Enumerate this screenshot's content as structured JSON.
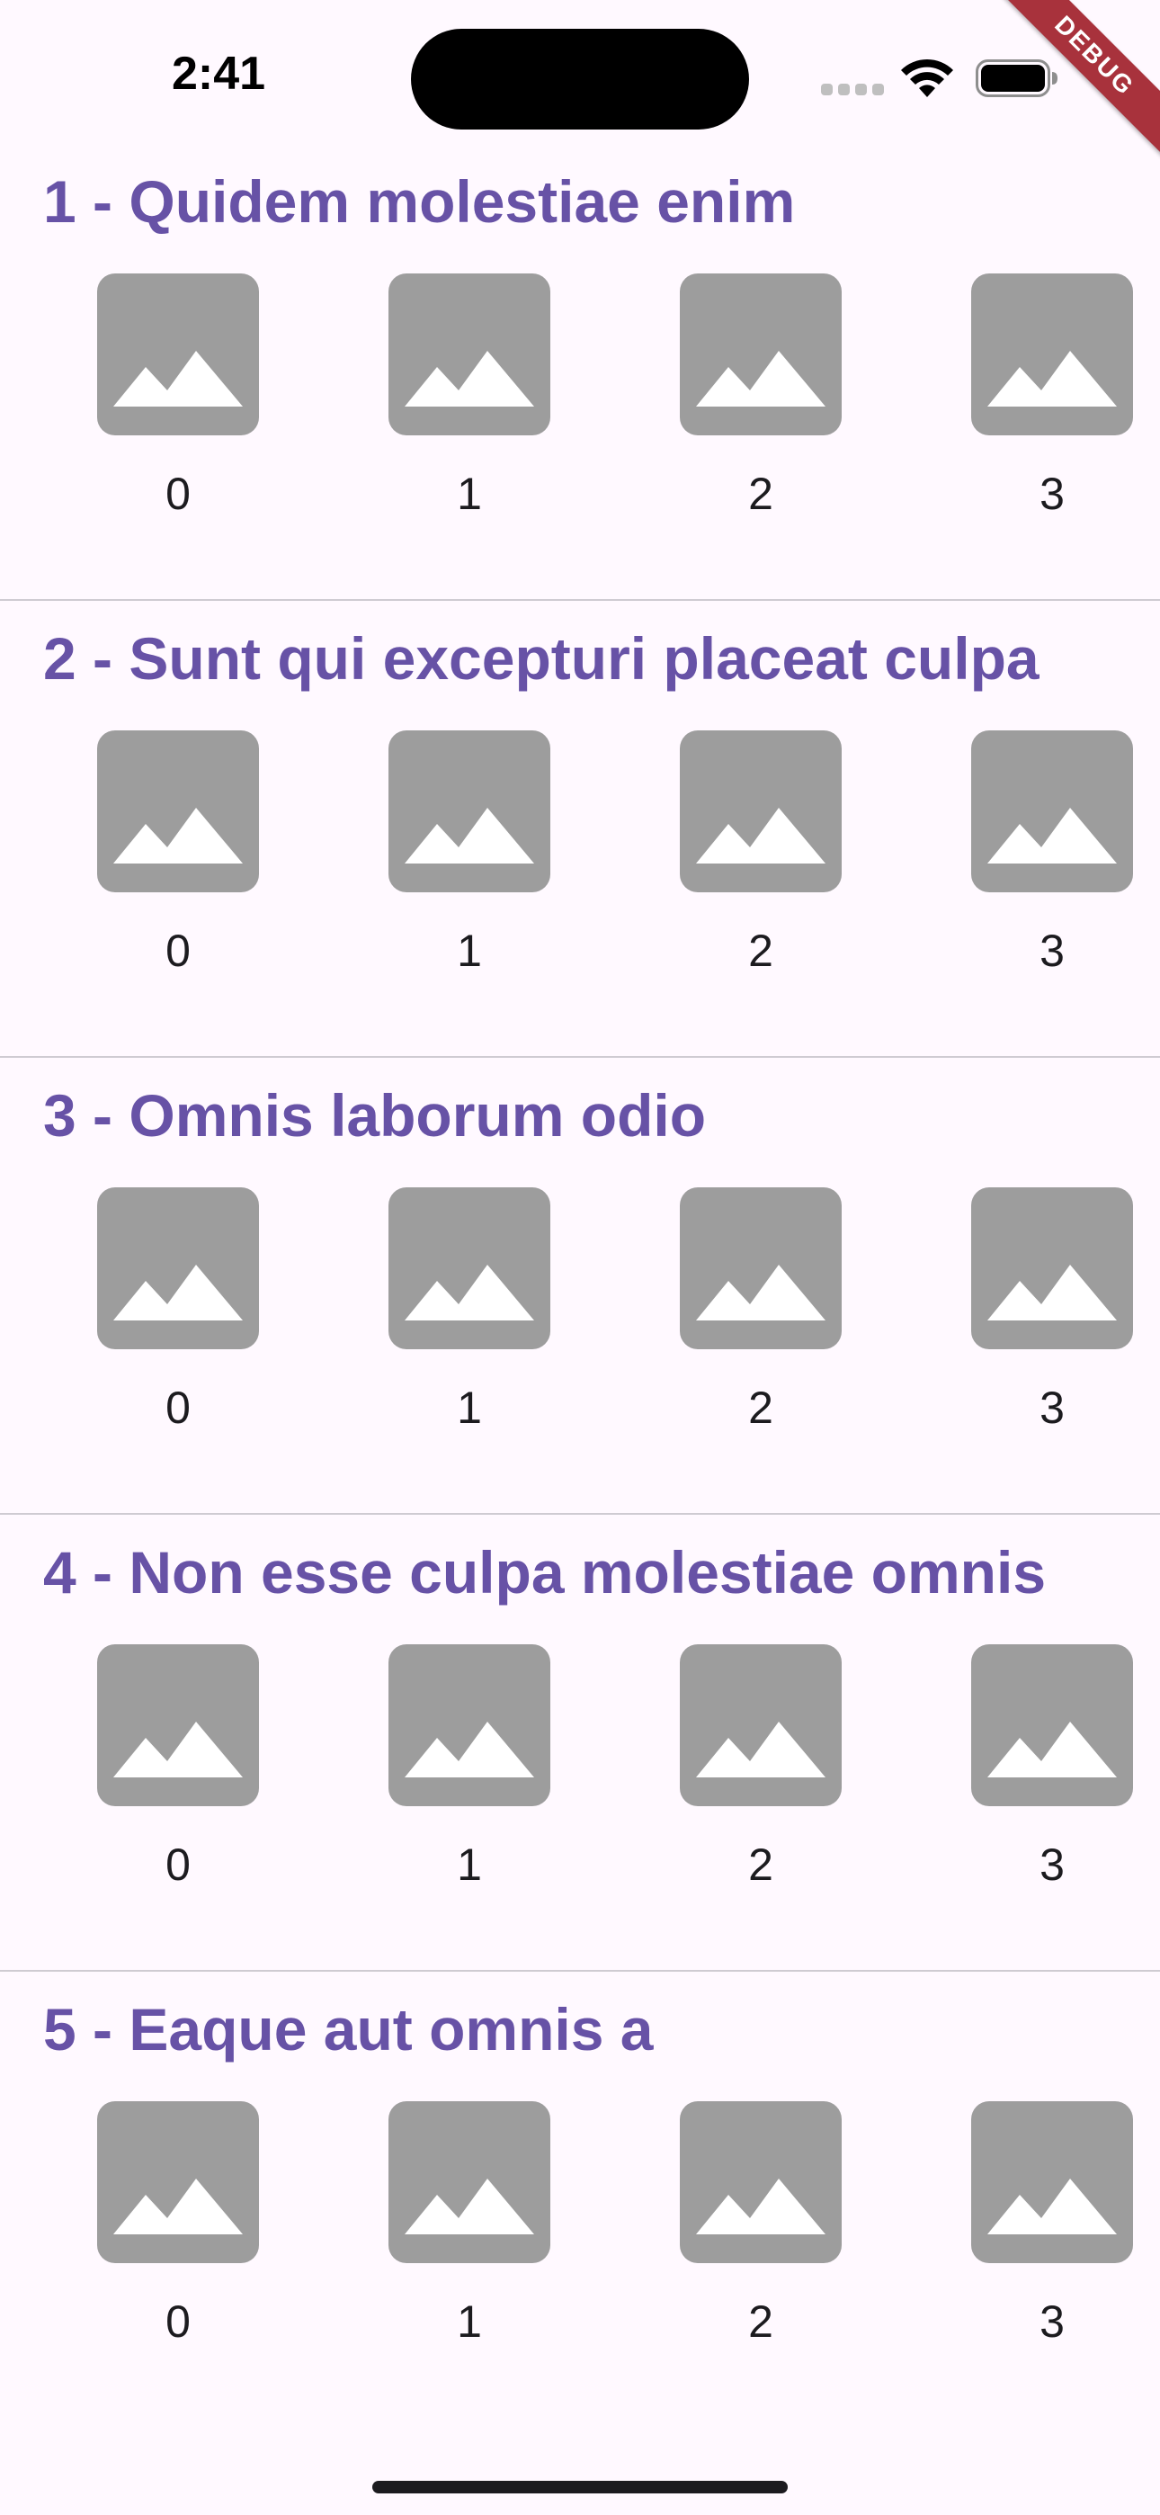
{
  "status_bar": {
    "time": "2:41",
    "debug_banner": "DEBUG"
  },
  "colors": {
    "background": "#fff9ff",
    "title": "#6752a6",
    "thumbnail": "#9d9d9d",
    "divider": "#cfcbd2",
    "debug_banner": "#a8323c"
  },
  "sections": [
    {
      "title": "1 - Quidem molestiae enim",
      "items": [
        "0",
        "1",
        "2",
        "3"
      ]
    },
    {
      "title": "2 - Sunt qui excepturi placeat culpa",
      "items": [
        "0",
        "1",
        "2",
        "3"
      ]
    },
    {
      "title": "3 - Omnis laborum odio",
      "items": [
        "0",
        "1",
        "2",
        "3"
      ]
    },
    {
      "title": "4 - Non esse culpa molestiae omnis",
      "items": [
        "0",
        "1",
        "2",
        "3"
      ]
    },
    {
      "title": "5 - Eaque aut omnis a",
      "items": [
        "0",
        "1",
        "2",
        "3"
      ]
    }
  ],
  "icons": {
    "thumbnail": "image-placeholder-icon",
    "wifi": "wifi-icon",
    "battery": "battery-icon",
    "signal": "cellular-signal-icon"
  }
}
